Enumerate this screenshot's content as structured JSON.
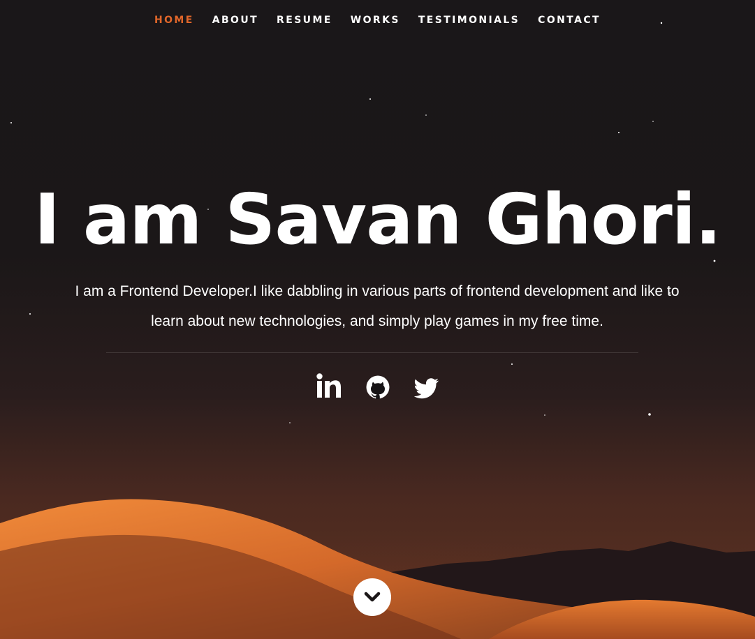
{
  "nav": {
    "items": [
      {
        "label": "HOME",
        "active": true
      },
      {
        "label": "ABOUT",
        "active": false
      },
      {
        "label": "RESUME",
        "active": false
      },
      {
        "label": "WORKS",
        "active": false
      },
      {
        "label": "TESTIMONIALS",
        "active": false
      },
      {
        "label": "CONTACT",
        "active": false
      }
    ]
  },
  "hero": {
    "headline": "I am Savan Ghori.",
    "intro": "I am a Frontend Developer.I like dabbling in various parts of frontend development and like to learn about new technologies, and simply play games in my free time."
  },
  "social": {
    "icons": [
      "linkedin-icon",
      "github-icon",
      "twitter-icon"
    ]
  },
  "scroll": {
    "icon": "chevron-down-icon"
  },
  "colors": {
    "accent": "#e0662a",
    "text": "#ffffff",
    "background": "#171416",
    "dune": "#d8722c"
  }
}
